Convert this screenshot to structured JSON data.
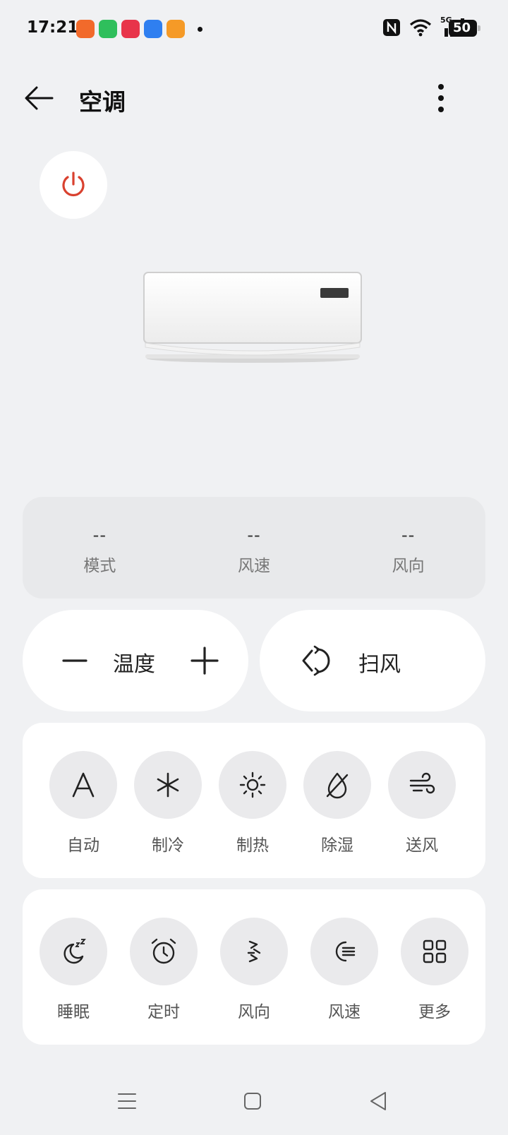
{
  "status_bar": {
    "time": "17:21",
    "network": "5G",
    "battery": "50",
    "app_icon_colors": [
      "#f26a2b",
      "#2fbf5c",
      "#e8344a",
      "#2f7ff0",
      "#f59a27"
    ]
  },
  "app_bar": {
    "title": "空调"
  },
  "status_panel": [
    {
      "value": "--",
      "label": "模式"
    },
    {
      "value": "--",
      "label": "风速"
    },
    {
      "value": "--",
      "label": "风向"
    }
  ],
  "controls": {
    "temperature_label": "温度",
    "sweep_label": "扫风"
  },
  "modes": [
    {
      "label": "自动",
      "icon": "auto-icon"
    },
    {
      "label": "制冷",
      "icon": "snowflake-icon"
    },
    {
      "label": "制热",
      "icon": "sun-icon"
    },
    {
      "label": "除湿",
      "icon": "droplet-off-icon"
    },
    {
      "label": "送风",
      "icon": "wind-icon"
    }
  ],
  "functions": [
    {
      "label": "睡眠",
      "icon": "sleep-moon-icon"
    },
    {
      "label": "定时",
      "icon": "alarm-clock-icon"
    },
    {
      "label": "风向",
      "icon": "wind-direction-icon"
    },
    {
      "label": "风速",
      "icon": "fan-speed-icon"
    },
    {
      "label": "更多",
      "icon": "grid-more-icon"
    }
  ],
  "colors": {
    "background": "#f0f1f3",
    "power_accent": "#d9412f",
    "card": "#ffffff",
    "icon_circle": "#eaeaec"
  }
}
